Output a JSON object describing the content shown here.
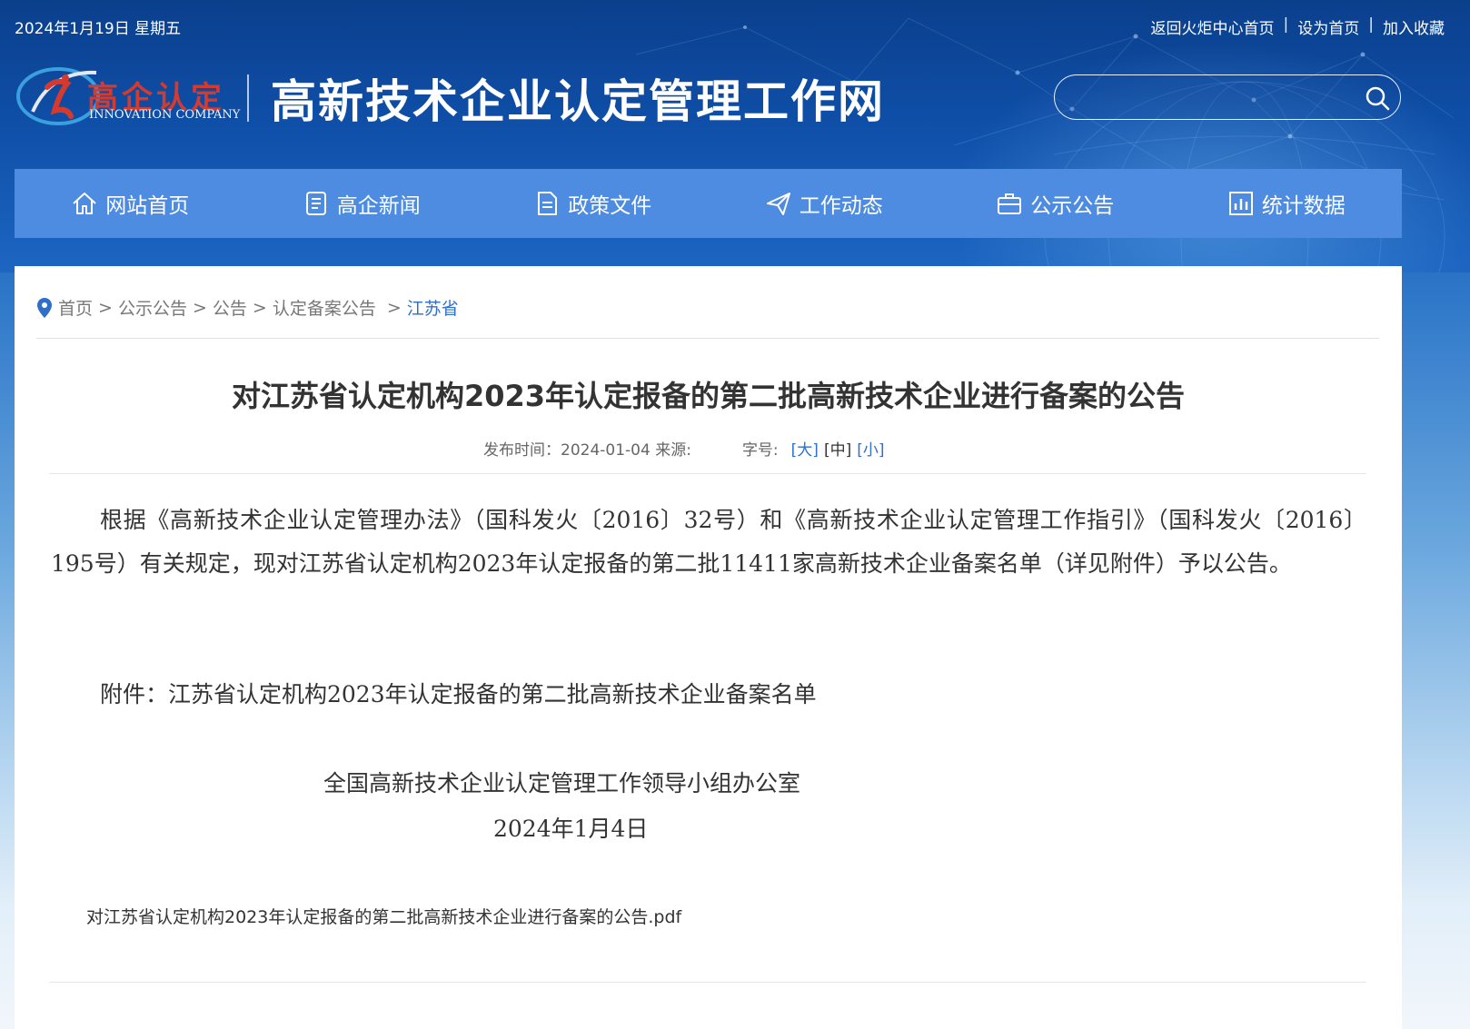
{
  "header": {
    "date": "2024年1月19日 星期五",
    "links": [
      "返回火炬中心首页",
      "设为首页",
      "加入收藏"
    ],
    "logo_cn": "高企认定",
    "logo_en": "INNOVATION COMPANY",
    "site_title": "高新技术企业认定管理工作网",
    "search": {
      "value": "",
      "placeholder": ""
    }
  },
  "nav": [
    {
      "label": "网站首页",
      "icon": "home-icon"
    },
    {
      "label": "高企新闻",
      "icon": "document-list-icon"
    },
    {
      "label": "政策文件",
      "icon": "file-icon"
    },
    {
      "label": "工作动态",
      "icon": "paper-plane-icon"
    },
    {
      "label": "公示公告",
      "icon": "briefcase-icon"
    },
    {
      "label": "统计数据",
      "icon": "bar-chart-icon"
    }
  ],
  "breadcrumb": {
    "items": [
      "首页",
      "公示公告",
      "公告",
      "认定备案公告"
    ],
    "current": "江苏省",
    "sep": ">"
  },
  "article": {
    "title": "对江苏省认定机构2023年认定报备的第二批高新技术企业进行备案的公告",
    "meta_publish": "发布时间：2024-01-04 来源:",
    "font_size_label": "字号:",
    "font_sizes": [
      "[大]",
      "[中]",
      "[小]"
    ],
    "paragraph": "根据《高新技术企业认定管理办法》（国科发火〔2016〕32号）和《高新技术企业认定管理工作指引》（国科发火〔2016〕195号）有关规定，现对江苏省认定机构2023年认定报备的第二批11411家高新技术企业备案名单（详见附件）予以公告。",
    "attachment": "附件：江苏省认定机构2023年认定报备的第二批高新技术企业备案名单",
    "signature_org": "全国高新技术企业认定管理工作领导小组办公室",
    "signature_date": "2024年1月4日",
    "pdf_link": "对江苏省认定机构2023年认定报备的第二批高新技术企业进行备案的公告.pdf"
  },
  "colors": {
    "nav_bg": "#4d8ce0",
    "header_bg": "#0f4fa8",
    "link": "#2f6fc7",
    "logo_red": "#d43a2e"
  }
}
